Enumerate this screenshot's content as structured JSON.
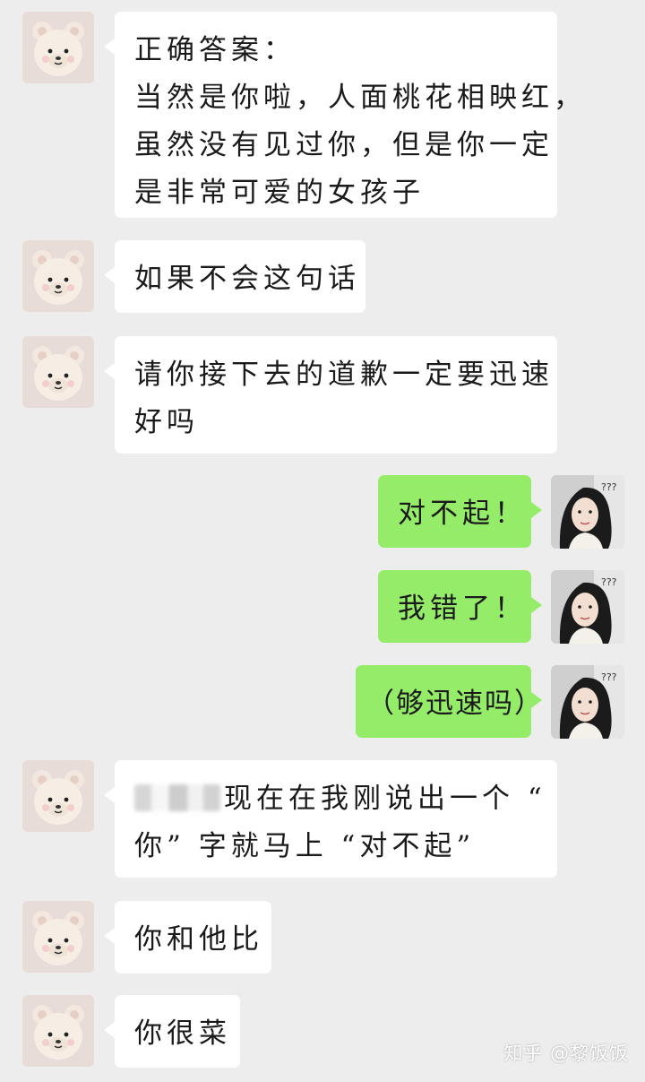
{
  "chat": {
    "messages": [
      {
        "sender": "other",
        "lines": [
          "正确答案：",
          "当然是你啦，人面桃花相映红，",
          "虽然没有见过你，但是你一定",
          "是非常可爱的女孩子"
        ]
      },
      {
        "sender": "other",
        "lines": [
          "如果不会这句话"
        ]
      },
      {
        "sender": "other",
        "lines": [
          "请你接下去的道歉一定要迅速",
          "好吗"
        ]
      },
      {
        "sender": "me",
        "lines": [
          "对不起！"
        ]
      },
      {
        "sender": "me",
        "lines": [
          "我错了！"
        ]
      },
      {
        "sender": "me",
        "lines": [
          "（够迅速吗）"
        ]
      },
      {
        "sender": "other",
        "lines": [
          "现在在我刚说出一个 “",
          "你” 字就马上 “对不起”"
        ]
      },
      {
        "sender": "other",
        "lines": [
          "你和他比"
        ]
      },
      {
        "sender": "other",
        "lines": [
          "你很菜"
        ]
      }
    ]
  },
  "avatars": {
    "other": {
      "icon": "teddy-bear-avatar-icon"
    },
    "me": {
      "icon": "girl-photo-avatar-icon",
      "overlay_text": "???"
    }
  },
  "watermark": "知乎 @黎饭饭",
  "colors": {
    "background": "#ededed",
    "incoming_bubble": "#ffffff",
    "outgoing_bubble": "#95ec69"
  }
}
